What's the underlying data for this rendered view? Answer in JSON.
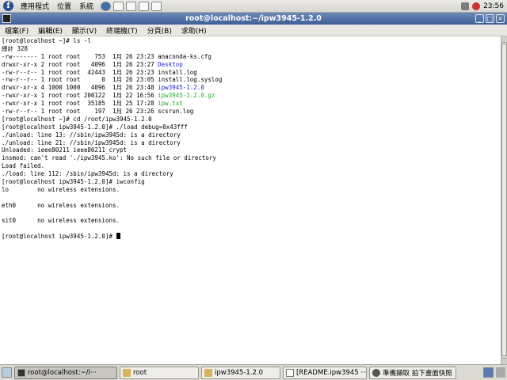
{
  "top_panel": {
    "menus": [
      "應用程式",
      "位置",
      "系統"
    ],
    "launchers": [
      "globe-launcher-icon",
      "mail-launcher-icon",
      "editor-launcher-icon",
      "presentation-launcher-icon",
      "spreadsheet-launcher-icon"
    ],
    "clock": "23:56"
  },
  "window": {
    "title": "root@localhost:~/ipw3945-1.2.0",
    "menus": [
      "檔案(F)",
      "編輯(E)",
      "顯示(V)",
      "終端機(T)",
      "分頁(B)",
      "求助(H)"
    ]
  },
  "terminal": {
    "lines": [
      {
        "text": "[root@localhost ~]# ls -l",
        "color": ""
      },
      {
        "text": "總計 328",
        "color": ""
      },
      {
        "text": "-rw------- 1 root root    753  1月 26 23:23 anaconda-ks.cfg",
        "color": ""
      },
      {
        "text": "drwxr-xr-x 2 root root   4096  1月 26 23:27 ",
        "suffix": "Desktop",
        "suffix_color": "blue"
      },
      {
        "text": "-rw-r--r-- 1 root root  42443  1月 26 23:23 install.log",
        "color": ""
      },
      {
        "text": "-rw-r--r-- 1 root root      0  1月 26 23:05 install.log.syslog",
        "color": ""
      },
      {
        "text": "drwxr-xr-x 4 1000 1000   4096  1月 26 23:48 ",
        "suffix": "ipw3945-1.2.0",
        "suffix_color": "blue"
      },
      {
        "text": "-rwxr-xr-x 1 root root 200122  1月 22 16:56 ",
        "suffix": "ipw3945-1.2.0.gz",
        "suffix_color": "green"
      },
      {
        "text": "-rwxr-xr-x 1 root root  35185  1月 25 17:28 ",
        "suffix": "ipw.txt",
        "suffix_color": "green"
      },
      {
        "text": "-rw-r--r-- 1 root root    197  1月 26 23:26 scsrun.log",
        "color": ""
      },
      {
        "text": "[root@localhost ~]# cd /root/ipw3945-1.2.0",
        "color": ""
      },
      {
        "text": "[root@localhost ipw3945-1.2.0]# ./load debug=0x43fff",
        "color": ""
      },
      {
        "text": "./unload: line 13: //sbin/ipw3945d: is a directory",
        "color": ""
      },
      {
        "text": "./unload: line 21: //sbin/ipw3945d: is a directory",
        "color": ""
      },
      {
        "text": "Unloaded: ieee80211 ieee80211_crypt",
        "color": ""
      },
      {
        "text": "insmod: can't read './ipw3945.ko': No such file or directory",
        "color": ""
      },
      {
        "text": "Load failed.",
        "color": ""
      },
      {
        "text": "./load: line 112: /sbin/ipw3945d: is a directory",
        "color": ""
      },
      {
        "text": "[root@localhost ipw3945-1.2.0]# iwconfig",
        "color": ""
      },
      {
        "text": "lo        no wireless extensions.",
        "color": ""
      },
      {
        "text": "",
        "color": ""
      },
      {
        "text": "eth0      no wireless extensions.",
        "color": ""
      },
      {
        "text": "",
        "color": ""
      },
      {
        "text": "sit0      no wireless extensions.",
        "color": ""
      },
      {
        "text": "",
        "color": ""
      },
      {
        "text": "[root@localhost ipw3945-1.2.0]# ",
        "color": "",
        "cursor": true
      }
    ],
    "colors": {
      "blue": "#2222cc",
      "green": "#22aa22"
    }
  },
  "taskbar": {
    "tasks": [
      {
        "label": "root@localhost:~/i···",
        "icon": "terminal-icon",
        "active": true
      },
      {
        "label": "root",
        "icon": "folder-icon",
        "active": false
      },
      {
        "label": "ipw3945-1.2.0",
        "icon": "folder-icon",
        "active": false
      },
      {
        "label": "[README.ipw3945 ···",
        "icon": "document-icon",
        "active": false
      },
      {
        "label": "準備擷取 拍下畫面快照",
        "icon": "screenshot-icon",
        "active": false
      }
    ]
  }
}
